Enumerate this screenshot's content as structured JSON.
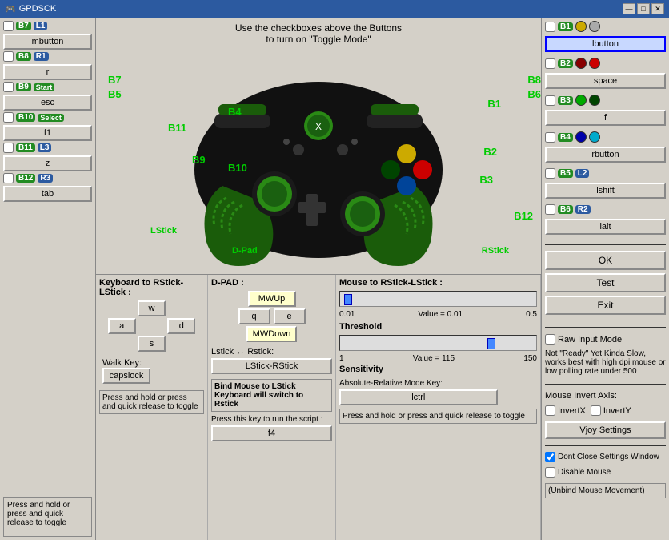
{
  "titleBar": {
    "title": "GPDSCK",
    "minBtn": "—",
    "maxBtn": "□",
    "closeBtn": "✕"
  },
  "toggleNote": {
    "line1": "Use the checkboxes above the Buttons",
    "line2": "to turn on \"Toggle Mode\""
  },
  "leftPanel": {
    "buttons": [
      {
        "id": "B7",
        "badge": "L1",
        "key": "mbutton"
      },
      {
        "id": "B8",
        "badge": "R1",
        "key": "r"
      },
      {
        "id": "B9",
        "badge": "Start",
        "key": "esc"
      },
      {
        "id": "B10",
        "badge": "Select",
        "key": "f1"
      },
      {
        "id": "B11",
        "badge": "L3",
        "key": "z"
      },
      {
        "id": "B12",
        "badge": "R3",
        "key": "tab"
      }
    ],
    "pressHoldText": "Press and hold or press and quick release to toggle"
  },
  "rightPanel": {
    "buttons": [
      {
        "id": "B1",
        "colors": [
          "yellow",
          "silver"
        ],
        "key": "lbutton",
        "highlighted": true
      },
      {
        "id": "B2",
        "colors": [
          "darkred",
          "red"
        ],
        "key": "space"
      },
      {
        "id": "B3",
        "colors": [
          "green",
          "darkgreen"
        ],
        "key": "f"
      },
      {
        "id": "B4",
        "colors": [
          "darkblue",
          "lightblue"
        ],
        "key": "rbutton"
      },
      {
        "id": "B5",
        "badge": "L2",
        "colors": [],
        "key": "lshift"
      },
      {
        "id": "B6",
        "badge": "R2",
        "colors": [],
        "key": "lalt"
      }
    ],
    "actionButtons": [
      "OK",
      "Test",
      "Exit"
    ],
    "rawInputMode": "Raw Input Mode",
    "rawInputNote": "Not \"Ready\" Yet Kinda Slow, works best with high dpi mouse or low polling rate under 500",
    "mouseInvertAxis": "Mouse Invert Axis:",
    "invertX": "InvertX",
    "invertY": "InvertY",
    "vjoySettings": "Vjoy Settings"
  },
  "controllerLabels": {
    "B7": "B7",
    "B5": "B5",
    "B8": "B8",
    "B6": "B6",
    "B11": "B11",
    "B4": "B4",
    "B1": "B1",
    "B9": "B9",
    "B10": "B10",
    "B2": "B2",
    "B3": "B3",
    "B12": "B12",
    "LStick": "LStick",
    "RStick": "RStick",
    "DPad": "D-Pad"
  },
  "dpad": {
    "title": "D-PAD :",
    "up": "MWUp",
    "left": "q",
    "right": "e",
    "down": "MWDown",
    "lstickRstick": "Lstick ↔ Rstick:",
    "switchBtn": "LStick-RStick",
    "bindNote": "Bind Mouse to LStick Keyboard will switch to Rstick",
    "pressThisKey": "Press this key to run the script :",
    "scriptKey": "f4"
  },
  "mouseSection": {
    "title": "Mouse to RStick-LStick :",
    "threshold": "Threshold",
    "sensitivity": "Sensitivity",
    "slider1": {
      "min": "0.01",
      "value": "Value = 0.01",
      "max": "0.5"
    },
    "slider2": {
      "min": "1",
      "value": "Value = 115",
      "max": "150"
    },
    "absRelTitle": "Absolute-Relative Mode Key:",
    "absRelKey": "lctrl",
    "pressHoldText": "Press and hold or press and quick release to toggle",
    "dontClose": "Dont Close Settings Window",
    "disableMouse": "Disable Mouse",
    "unbindNote": "(Unbind Mouse Movement)"
  }
}
